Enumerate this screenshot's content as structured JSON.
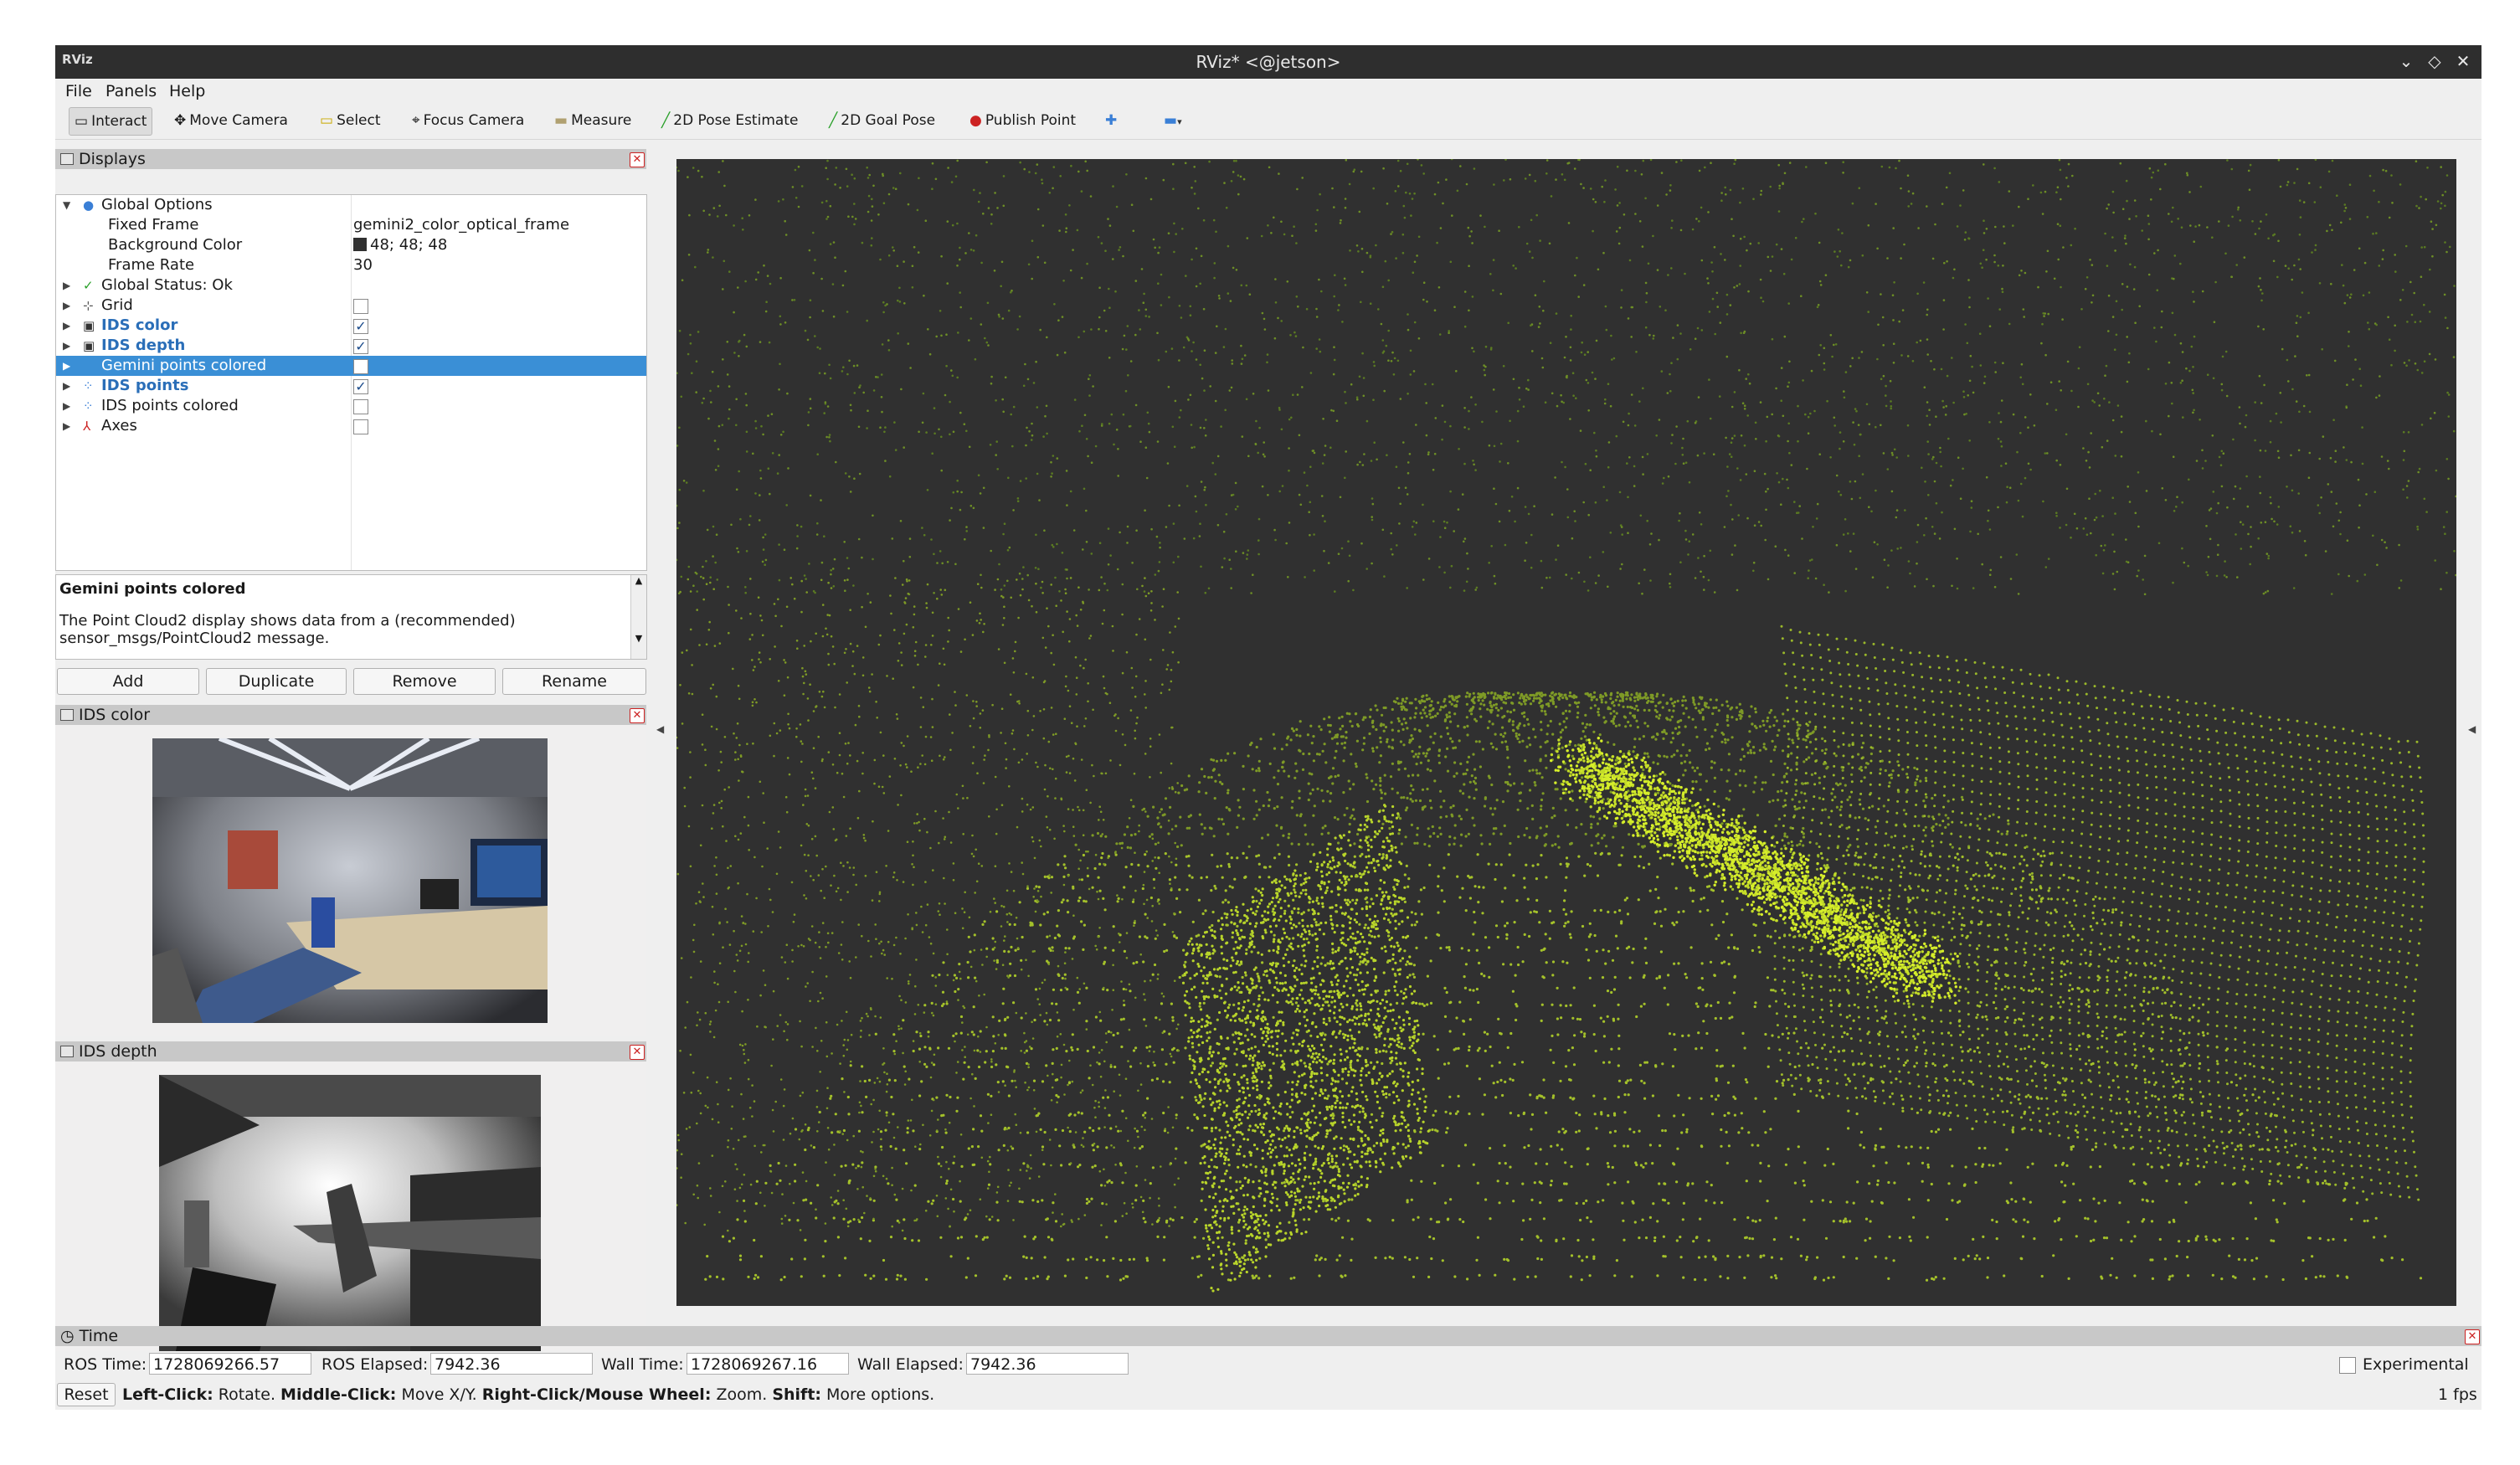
{
  "window": {
    "logo": "RViz",
    "title": "RViz* <@jetson>",
    "controls": [
      "minimize-icon",
      "maximize-icon",
      "close-icon"
    ]
  },
  "menu": [
    {
      "label": "File"
    },
    {
      "label": "Panels"
    },
    {
      "label": "Help"
    }
  ],
  "toolbar": {
    "interact": "Interact",
    "move_camera": "Move Camera",
    "select": "Select",
    "focus_camera": "Focus Camera",
    "measure": "Measure",
    "pose_estimate": "2D Pose Estimate",
    "goal_pose": "2D Goal Pose",
    "publish_point": "Publish Point"
  },
  "displays": {
    "header": "Displays",
    "global_options": "Global Options",
    "fixed_frame_label": "Fixed Frame",
    "fixed_frame_value": "gemini2_color_optical_frame",
    "bg_color_label": "Background Color",
    "bg_color_value": "48; 48; 48",
    "bg_color_hex": "#303030",
    "frame_rate_label": "Frame Rate",
    "frame_rate_value": "30",
    "global_status": "Global Status: Ok",
    "items": [
      {
        "label": "Grid",
        "checked": false
      },
      {
        "label": "IDS color",
        "checked": true
      },
      {
        "label": "IDS depth",
        "checked": true
      },
      {
        "label": "Gemini points colored",
        "checked": false
      },
      {
        "label": "IDS points",
        "checked": true
      },
      {
        "label": "IDS points colored",
        "checked": false
      },
      {
        "label": "Axes",
        "checked": false
      }
    ],
    "description_title": "Gemini points colored",
    "description_text": "The Point Cloud2 display shows data from a (recommended) sensor_msgs/PointCloud2 message.",
    "buttons": {
      "add": "Add",
      "duplicate": "Duplicate",
      "remove": "Remove",
      "rename": "Rename"
    }
  },
  "ids_color_panel": {
    "header": "IDS color"
  },
  "ids_depth_panel": {
    "header": "IDS depth"
  },
  "time": {
    "header": "Time",
    "ros_time_label": "ROS Time:",
    "ros_time": "1728069266.57",
    "ros_elapsed_label": "ROS Elapsed:",
    "ros_elapsed": "7942.36",
    "wall_time_label": "Wall Time:",
    "wall_time": "1728069267.16",
    "wall_elapsed_label": "Wall Elapsed:",
    "wall_elapsed": "7942.36",
    "experimental": "Experimental"
  },
  "status": {
    "reset": "Reset",
    "hint_left_key": "Left-Click:",
    "hint_left": " Rotate. ",
    "hint_middle_key": "Middle-Click:",
    "hint_middle": " Move X/Y. ",
    "hint_right_key": "Right-Click/Mouse Wheel:",
    "hint_right": " Zoom. ",
    "hint_shift_key": "Shift:",
    "hint_shift": " More options.",
    "fps": "1 fps"
  },
  "colors": {
    "accent": "#3a8fd6",
    "pointcloud": "#b8d42a",
    "viewport_bg": "#303030"
  }
}
